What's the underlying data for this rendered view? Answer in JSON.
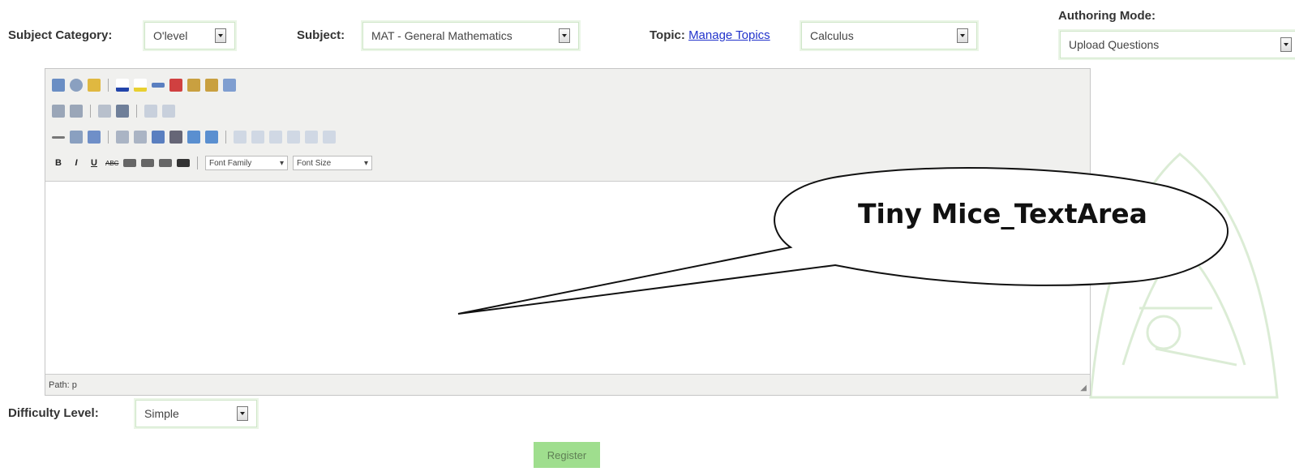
{
  "filters": {
    "subject_category": {
      "label": "Subject Category:",
      "value": "O'level"
    },
    "subject": {
      "label": "Subject:",
      "value": "MAT - General Mathematics"
    },
    "topic": {
      "label": "Topic:",
      "manage_link": "Manage Topics",
      "value": "Calculus"
    },
    "authoring_mode": {
      "label": "Authoring Mode:",
      "value": "Upload Questions"
    }
  },
  "editor": {
    "font_family_placeholder": "Font Family",
    "font_size_placeholder": "Font Size",
    "path_text": "Path: p",
    "callout_text": "Tiny Mice_TextArea"
  },
  "difficulty": {
    "label": "Difficulty Level:",
    "value": "Simple"
  },
  "register_label": "Register"
}
